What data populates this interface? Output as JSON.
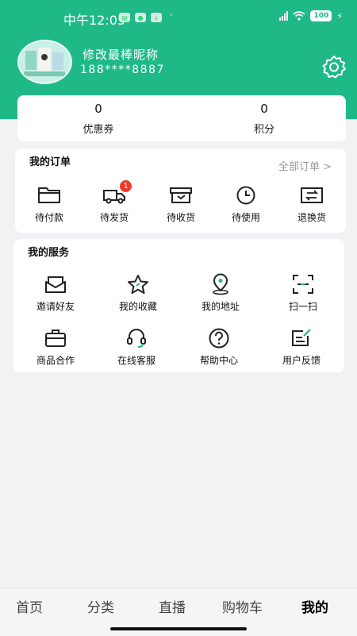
{
  "status_bar": {
    "time": "中午12:05",
    "battery": "100"
  },
  "profile": {
    "nickname": "修改最棒昵称",
    "phone": "188****8887"
  },
  "stats": [
    {
      "value": "0",
      "label": "优惠券"
    },
    {
      "value": "0",
      "label": "积分"
    }
  ],
  "orders": {
    "title": "我的订单",
    "all_link": "全部订单 >",
    "items": [
      {
        "label": "待付款",
        "icon": "wallet-icon"
      },
      {
        "label": "待发货",
        "icon": "truck-icon",
        "badge": "1"
      },
      {
        "label": "待收货",
        "icon": "box-icon"
      },
      {
        "label": "待使用",
        "icon": "clock-icon"
      },
      {
        "label": "退换货",
        "icon": "exchange-icon"
      }
    ]
  },
  "services": {
    "title": "我的服务",
    "items": [
      {
        "label": "邀请好友",
        "icon": "envelope-icon"
      },
      {
        "label": "我的收藏",
        "icon": "star-icon"
      },
      {
        "label": "我的地址",
        "icon": "location-icon"
      },
      {
        "label": "扫一扫",
        "icon": "scan-icon"
      },
      {
        "label": "商品合作",
        "icon": "briefcase-icon"
      },
      {
        "label": "在线客服",
        "icon": "headset-icon"
      },
      {
        "label": "帮助中心",
        "icon": "help-icon"
      },
      {
        "label": "用户反馈",
        "icon": "feedback-icon"
      }
    ]
  },
  "tabbar": [
    {
      "label": "首页"
    },
    {
      "label": "分类"
    },
    {
      "label": "直播"
    },
    {
      "label": "购物车"
    },
    {
      "label": "我的",
      "active": true
    }
  ],
  "colors": {
    "brand": "#1fb987",
    "badge": "#ef3a2a"
  }
}
